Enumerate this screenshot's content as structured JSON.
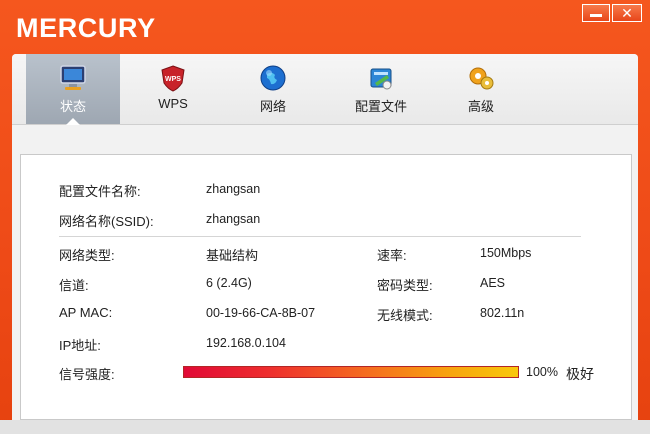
{
  "app": {
    "brand": "MERCURY",
    "close_glyph": "✕"
  },
  "tabs": [
    {
      "label": "状态",
      "icon": "monitor-icon",
      "active": true
    },
    {
      "label": "WPS",
      "icon": "wps-shield-icon",
      "active": false
    },
    {
      "label": "网络",
      "icon": "globe-icon",
      "active": false
    },
    {
      "label": "配置文件",
      "icon": "profile-icon",
      "active": false
    },
    {
      "label": "高级",
      "icon": "gear-icon",
      "active": false
    }
  ],
  "status": {
    "profile_name_label": "配置文件名称:",
    "profile_name_value": "zhangsan",
    "ssid_label": "网络名称(SSID):",
    "ssid_value": "zhangsan",
    "network_type_label": "网络类型:",
    "network_type_value": "基础结构",
    "rate_label": "速率:",
    "rate_value": "150Mbps",
    "channel_label": "信道:",
    "channel_value": "6 (2.4G)",
    "encryption_label": "密码类型:",
    "encryption_value": "AES",
    "ap_mac_label": "AP MAC:",
    "ap_mac_value": "00-19-66-CA-8B-07",
    "wireless_mode_label": "无线模式:",
    "wireless_mode_value": "802.11n",
    "ip_label": "IP地址:",
    "ip_value": "192.168.0.104",
    "signal_label": "信号强度:",
    "signal_percent": "100%",
    "signal_quality": "极好",
    "signal_level": 1.0
  },
  "colors": {
    "titlebar": "#ef4d18",
    "active_tab": "#a6afba"
  }
}
